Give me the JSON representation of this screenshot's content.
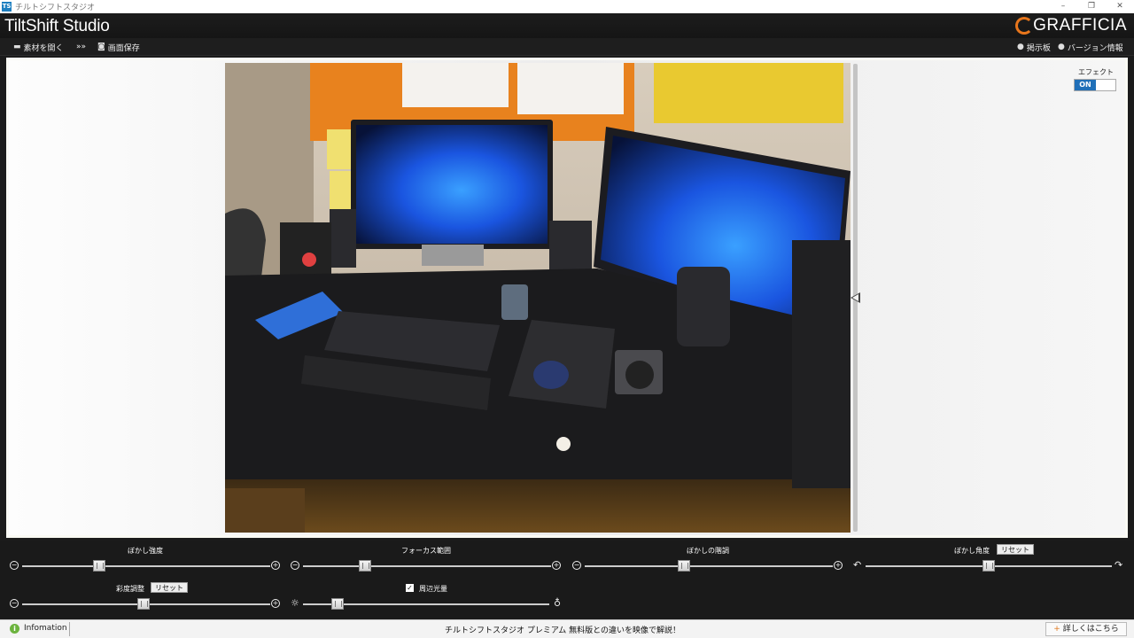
{
  "window": {
    "title": "チルトシフトスタジオ",
    "app_icon": "TS",
    "controls": [
      "–",
      "❐",
      "✕"
    ]
  },
  "header": {
    "app_name": "TiltShift Studio",
    "brand": "GRAFFICIA"
  },
  "toolbar": {
    "open_label": "素材を開く",
    "more_label": "»»",
    "save_label": "画面保存",
    "board_label": "掲示板",
    "version_label": "バージョン情報"
  },
  "effect": {
    "label": "エフェクト",
    "state": "ON"
  },
  "photo": {
    "accent_colors": {
      "wall_board": "#e8821e",
      "screen": "#1a55e0",
      "note": "#e9c930"
    }
  },
  "controls": {
    "blur_strength": {
      "label": "ぼかし強度",
      "value": 0.31
    },
    "focus_range": {
      "label": "フォーカス範囲",
      "value": 0.25
    },
    "blur_gradient": {
      "label": "ぼかしの階調",
      "value": 0.4
    },
    "blur_angle": {
      "label": "ぼかし角度",
      "reset": "リセット",
      "value": 0.5
    },
    "saturation": {
      "label": "彩度調整",
      "reset": "リセット",
      "value": 0.49
    },
    "vignette": {
      "label": "周辺光量",
      "checked": true,
      "value": 0.14
    }
  },
  "status": {
    "info_label": "Infomation",
    "promo": "チルトシフトスタジオ プレミアム 無料版との違いを映像で解説！",
    "more_label": "詳しくはこちら"
  },
  "colors": {
    "accent": "#1f6fb8",
    "brand_orange": "#e8761c",
    "info_green": "#6cb33e"
  }
}
